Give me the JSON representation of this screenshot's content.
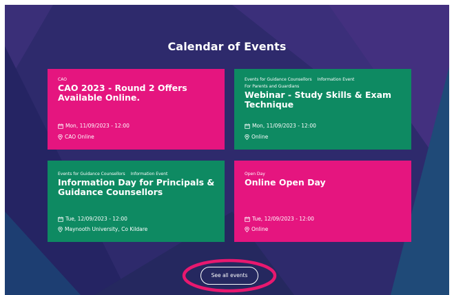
{
  "section": {
    "title": "Calendar of Events"
  },
  "events": [
    {
      "tags": [
        "CAO"
      ],
      "title": "CAO 2023 - Round 2 Offers Available Online.",
      "date": "Mon, 11/09/2023 - 12:00",
      "location": "CAO Online",
      "color": "#e5157f"
    },
    {
      "tags": [
        "Events for Guidance Counsellors",
        "Information Event",
        "For Parents and Guardians"
      ],
      "title": "Webinar - Study Skills & Exam Technique",
      "date": "Mon, 11/09/2023 - 12:00",
      "location": "Online",
      "color": "#0e8a62"
    },
    {
      "tags": [
        "Events for Guidance Counsellors",
        "Information Event"
      ],
      "title": "Information Day for Principals & Guidance Counsellors",
      "date": "Tue, 12/09/2023 - 12:00",
      "location": "Maynooth University, Co Kildare",
      "color": "#0e8a62"
    },
    {
      "tags": [
        "Open Day"
      ],
      "title": "Online Open Day",
      "date": "Tue, 12/09/2023 - 12:00",
      "location": "Online",
      "color": "#e5157f"
    }
  ],
  "button": {
    "label": "See all events"
  },
  "icons": {
    "date": "calendar-icon",
    "location": "map-pin-icon"
  },
  "colors": {
    "background": "#2e2a6c",
    "pink": "#e5157f",
    "green": "#0e8a62",
    "highlight": "#e8186f"
  }
}
